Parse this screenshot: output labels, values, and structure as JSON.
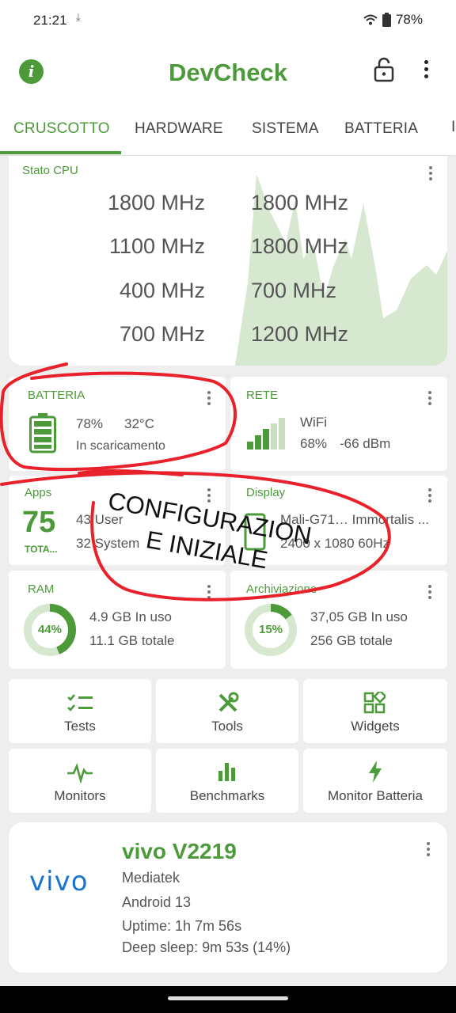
{
  "status": {
    "time": "21:21",
    "battery_pct": "78%"
  },
  "app": {
    "title": "DevCheck"
  },
  "tabs": [
    "CRUSCOTTO",
    "HARDWARE",
    "SISTEMA",
    "BATTERIA"
  ],
  "cpu": {
    "title": "Stato CPU",
    "left": [
      "1800 MHz",
      "1100 MHz",
      "400 MHz",
      "700 MHz"
    ],
    "right": [
      "1800 MHz",
      "1800 MHz",
      "700 MHz",
      "1200 MHz"
    ]
  },
  "battery": {
    "title": "BATTERIA",
    "pct": "78%",
    "temp": "32°C",
    "state": "In scaricamento",
    "level": 0.78
  },
  "network": {
    "title": "RETE",
    "type": "WiFi",
    "pct": "68%",
    "dbm": "-66 dBm"
  },
  "apps": {
    "title": "Apps",
    "count": "75",
    "total_label": "TOTA...",
    "user": "43 User",
    "system": "32 System"
  },
  "display": {
    "title": "Display",
    "gpu": "Mali-G71… Immortalis ...",
    "res": "2400 x 1080  60Hz"
  },
  "ram": {
    "title": "RAM",
    "pct_label": "44%",
    "fraction": 0.44,
    "used": "4.9 GB In uso",
    "total": "11.1 GB totale"
  },
  "storage": {
    "title": "Archiviazione",
    "pct_label": "15%",
    "fraction": 0.15,
    "used": "37,05 GB In uso",
    "total": "256 GB totale"
  },
  "tiles": {
    "tests": "Tests",
    "tools": "Tools",
    "widgets": "Widgets",
    "monitors": "Monitors",
    "benchmarks": "Benchmarks",
    "battery_monitor": "Monitor Batteria"
  },
  "device": {
    "logo": "vivo",
    "name": "vivo V2219",
    "chip": "Mediatek",
    "android": "Android 13",
    "uptime": "Uptime: 1h 7m 56s",
    "deep_sleep": "Deep sleep: 9m 53s (14%)"
  },
  "annotation": {
    "line1": "CONFIGURAZION",
    "line2": "E INIZIALE"
  },
  "colors": {
    "accent": "#4c9a3a",
    "chart_fill": "#d6e8cf",
    "scribble": "#e8212b"
  }
}
